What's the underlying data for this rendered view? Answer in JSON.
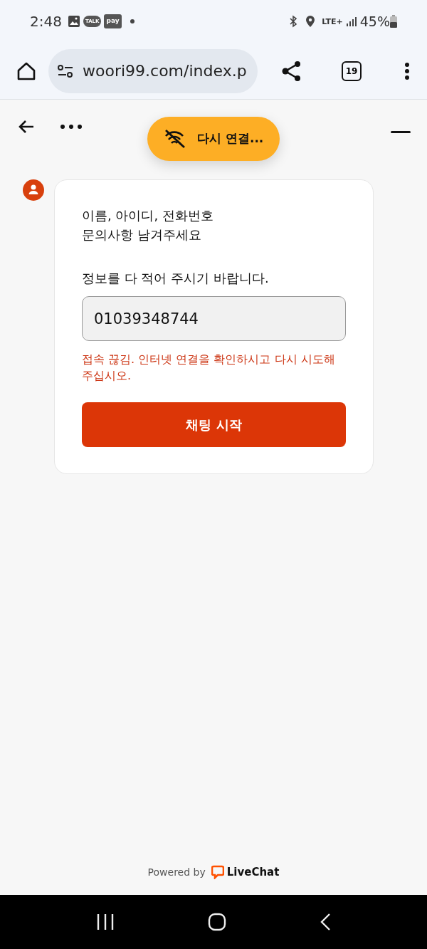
{
  "status_bar": {
    "time": "2:48",
    "talk_badge": "TALK",
    "pay_badge": "pay",
    "network": "LTE+",
    "battery": "45%"
  },
  "browser": {
    "url": "woori99.com/index.p",
    "tab_count": "19"
  },
  "chat_header": {
    "reconnect_toast": "다시 연결..."
  },
  "form": {
    "prompt_lines": [
      "이름, 아이디, 전화번호",
      "문의사항 남겨주세요"
    ],
    "field_label": "정보를 다 적어 주시기 바랍니다.",
    "field_value": "01039348744",
    "error": "접속 끊김. 인터넷 연결을 확인하시고 다시 시도해 주십시오.",
    "submit": "채팅 시작"
  },
  "footer": {
    "powered_by": "Powered by",
    "brand": "LiveChat"
  }
}
